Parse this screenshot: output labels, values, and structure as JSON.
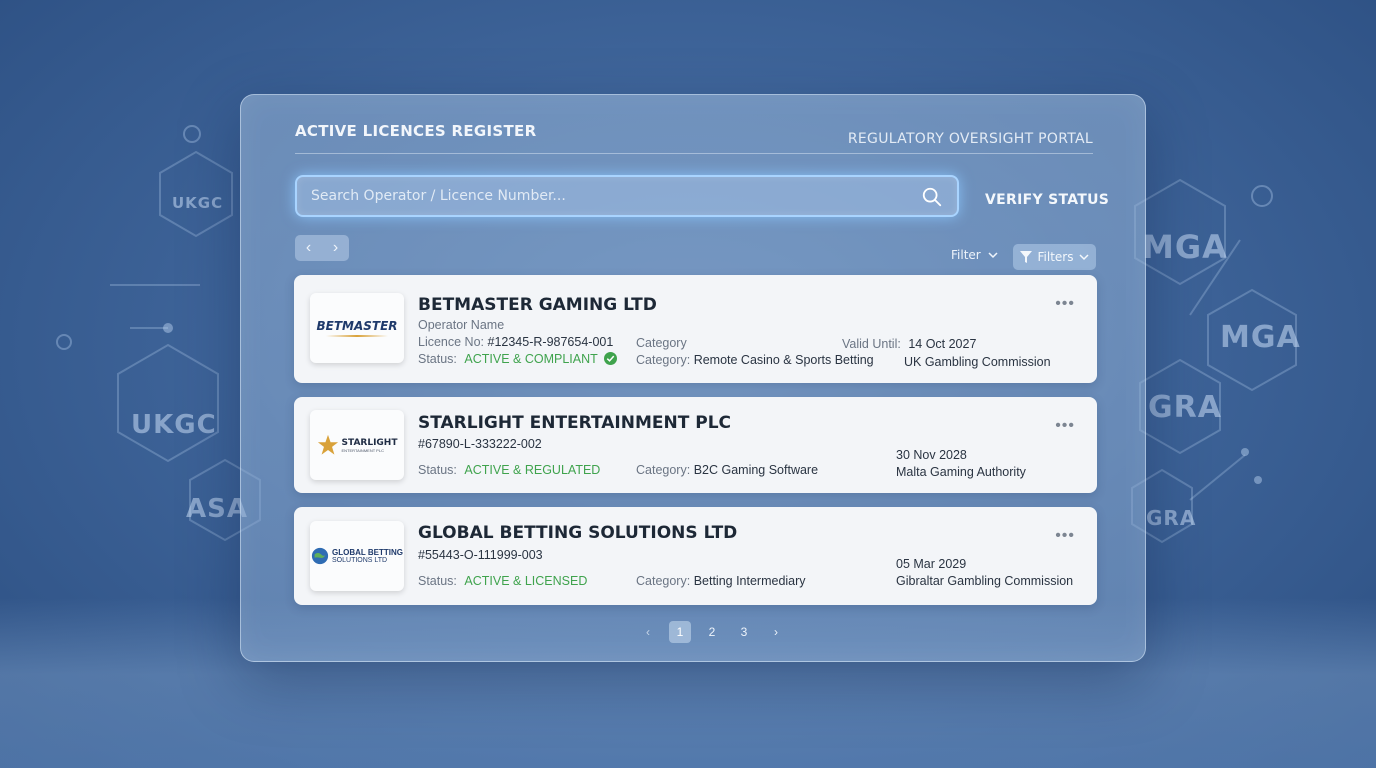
{
  "header": {
    "title": "ACTIVE LICENCES REGISTER",
    "portal": "REGULATORY OVERSIGHT PORTAL"
  },
  "search": {
    "placeholder": "Search Operator / Licence Number...",
    "verify_label": "VERIFY STATUS"
  },
  "toolbar": {
    "filter_label": "Filter",
    "filters_label": "Filters"
  },
  "background": {
    "marks": [
      "UKGC",
      "UKGC",
      "MGA",
      "MGA",
      "GRA",
      "ASA",
      "GRA"
    ]
  },
  "records": [
    {
      "logo_text": "BETMASTER",
      "name": "BETMASTER GAMING LTD",
      "name_caption": "Operator Name",
      "licence_label": "Licence No:",
      "licence": "#12345-R-987654-001",
      "status_label": "Status:",
      "status": "ACTIVE & COMPLIANT",
      "category_caption": "Category",
      "category_label": "Category:",
      "category": "Remote Casino & Sports Betting",
      "valid_label": "Valid Until:",
      "valid_until": "14 Oct 2027",
      "authority": "UK Gambling Commission"
    },
    {
      "logo_text": "STARLIGHT",
      "logo_sub": "ENTERTAINMENT PLC",
      "name": "STARLIGHT ENTERTAINMENT PLC",
      "licence": "#67890-L-333222-002",
      "status_label": "Status:",
      "status": "ACTIVE & REGULATED",
      "category_label": "Category:",
      "category": "B2C Gaming Software",
      "valid_until": "30 Nov 2028",
      "authority": "Malta Gaming Authority"
    },
    {
      "logo_text": "GLOBAL BETTING",
      "logo_sub": "SOLUTIONS LTD",
      "name": "GLOBAL BETTING SOLUTIONS LTD",
      "licence": "#55443-O-111999-003",
      "status_label": "Status:",
      "status": "ACTIVE & LICENSED",
      "category_label": "Category:",
      "category": "Betting Intermediary",
      "valid_until": "05 Mar 2029",
      "authority": "Gibraltar Gambling Commission"
    }
  ],
  "pagination": {
    "prev": "‹",
    "pages": [
      "1",
      "2",
      "3"
    ],
    "next": "›"
  },
  "colors": {
    "accent_glow": "#a9d4ff",
    "status_green": "#3fa34d"
  }
}
